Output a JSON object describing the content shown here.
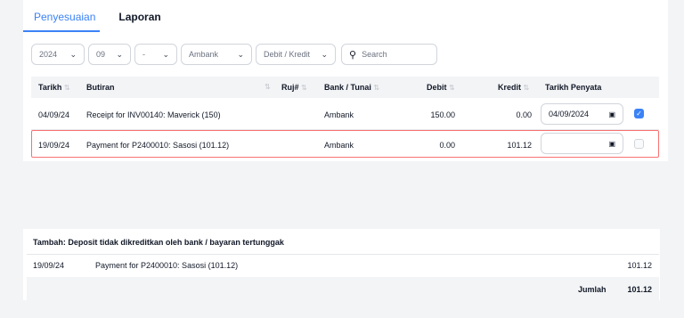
{
  "tabs": [
    {
      "label": "Penyesuaian",
      "active": true
    },
    {
      "label": "Laporan",
      "active": false
    }
  ],
  "filters": {
    "year": "2024",
    "month": "09",
    "dash": "-",
    "bank": "Ambank",
    "type": "Debit / Kredit",
    "search_placeholder": "Search"
  },
  "table": {
    "headers": {
      "date": "Tarikh",
      "desc": "Butiran",
      "ref": "Ruj#",
      "bank": "Bank / Tunai",
      "debit": "Debit",
      "credit": "Kredit",
      "stmt_date": "Tarikh Penyata"
    },
    "rows": [
      {
        "date": "04/09/24",
        "desc": "Receipt for INV00140: Maverick (150)",
        "bank": "Ambank",
        "debit": "150.00",
        "credit": "0.00",
        "stmt_date": "04/09/2024",
        "checked": true
      },
      {
        "date": "19/09/24",
        "desc": "Payment for P2400010: Sasosi (101.12)",
        "bank": "Ambank",
        "debit": "0.00",
        "credit": "101.12",
        "stmt_date": "",
        "checked": false
      }
    ]
  },
  "summary": {
    "title": "Tambah: Deposit tidak dikreditkan oleh bank / bayaran tertunggak",
    "row": {
      "date": "19/09/24",
      "desc": "Payment for P2400010: Sasosi (101.12)",
      "amount": "101.12"
    },
    "total_label": "Jumlah",
    "total_value": "101.12"
  },
  "colors": {
    "accent": "#3b82f6",
    "error": "#f87171"
  }
}
